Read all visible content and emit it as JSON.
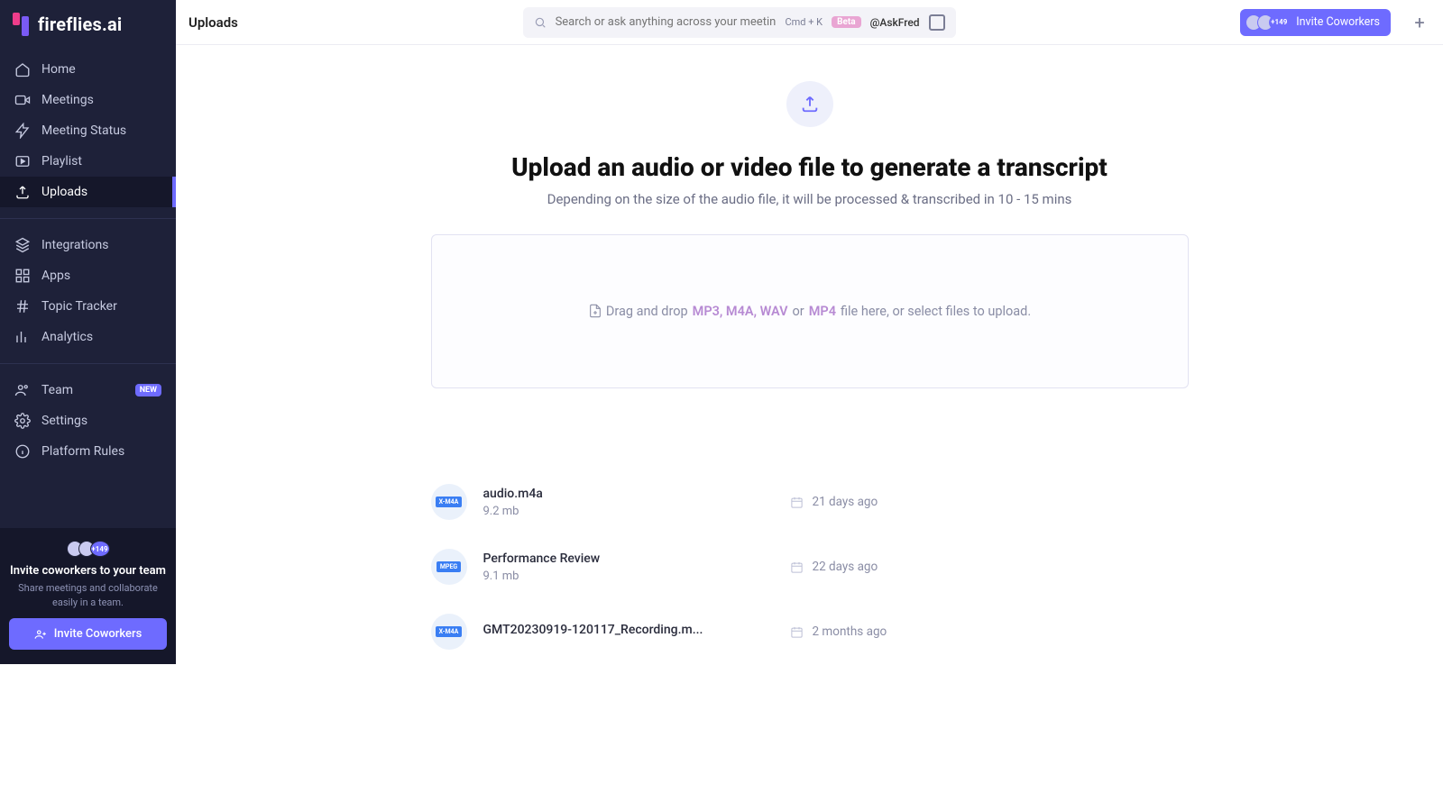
{
  "brand": "fireflies.ai",
  "page_title": "Uploads",
  "search": {
    "placeholder": "Search or ask anything across your meetings...",
    "shortcut": "Cmd + K",
    "beta": "Beta",
    "handle": "@AskFred"
  },
  "header": {
    "avatar_overflow": "+149",
    "invite_label": "Invite Coworkers"
  },
  "sidebar": {
    "items": [
      {
        "label": "Home",
        "icon": "home-icon"
      },
      {
        "label": "Meetings",
        "icon": "video-icon"
      },
      {
        "label": "Meeting Status",
        "icon": "bolt-icon"
      },
      {
        "label": "Playlist",
        "icon": "playlist-icon"
      },
      {
        "label": "Uploads",
        "icon": "upload-icon",
        "active": true
      },
      {
        "label": "Integrations",
        "icon": "layers-icon"
      },
      {
        "label": "Apps",
        "icon": "grid-icon"
      },
      {
        "label": "Topic Tracker",
        "icon": "hash-icon"
      },
      {
        "label": "Analytics",
        "icon": "bars-icon"
      },
      {
        "label": "Team",
        "icon": "people-icon",
        "badge": "NEW"
      },
      {
        "label": "Settings",
        "icon": "gear-icon"
      },
      {
        "label": "Platform Rules",
        "icon": "info-icon"
      }
    ],
    "invite": {
      "overflow": "+149",
      "title": "Invite coworkers to your team",
      "desc": "Share meetings and collaborate easily in a team.",
      "button": "Invite Coworkers"
    }
  },
  "hero": {
    "headline": "Upload an audio or video file to generate a transcript",
    "subhead": "Depending on the size of the audio file, it will be processed & transcribed in 10 - 15 mins",
    "dropzone_pre": "Drag and drop",
    "dropzone_fmt1": "MP3, M4A, WAV",
    "dropzone_or": "or",
    "dropzone_fmt2": "MP4",
    "dropzone_post": "file here, or select files to upload."
  },
  "uploads": [
    {
      "name": "audio.m4a",
      "size": "9.2 mb",
      "chip": "X-M4A",
      "date": "21 days ago"
    },
    {
      "name": "Performance Review",
      "size": "9.1 mb",
      "chip": "MPEG",
      "date": "22 days ago"
    },
    {
      "name": "GMT20230919-120117_Recording.m...",
      "size": "",
      "chip": "X-M4A",
      "date": "2 months ago"
    }
  ]
}
